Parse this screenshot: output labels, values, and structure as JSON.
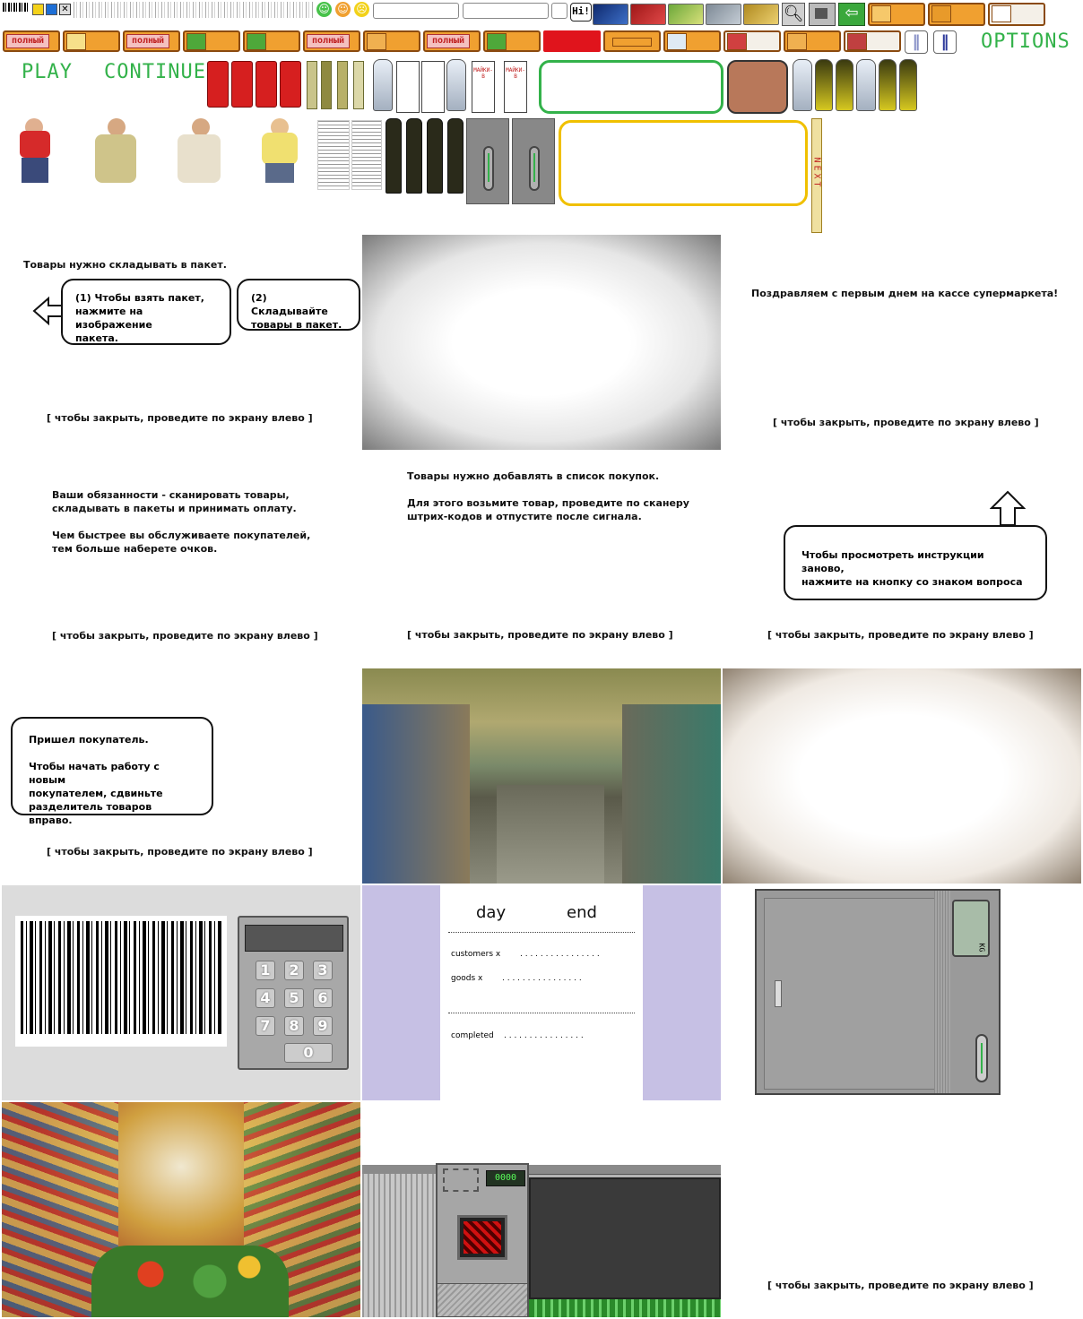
{
  "sprites": {
    "full_label": "полный",
    "hi_label": "Hi!",
    "play_label": "PLAY",
    "continue_label": "CONTINUE",
    "options_label": "OPTIONS",
    "next_label": "NEXT",
    "milk_brand": "МАЙКИ-В",
    "scale_unit": "KG"
  },
  "colors": {
    "menu_green": "#33b24a",
    "orange_button": "#f0a030",
    "red_button": "#e0141c",
    "yellow_frame": "#f0c000",
    "pause_blue": "#2d3a9b",
    "summary_lilac": "#c6c0e4"
  },
  "tutorial": {
    "bag_intro": "Товары нужно складывать в пакет.",
    "bag_step1": "(1) Чтобы взять пакет,\nнажмите на изображение\nпакета.",
    "bag_step2": "(2) Складывайте\nтовары в пакет.",
    "close_hint": "[ чтобы закрыть, проведите по экрану влево ]",
    "congrats": "Поздравляем с первым днем на кассе супермаркета!",
    "duties": "Ваши обязанности - сканировать товары,\nскладывать в пакеты и принимать оплату.\n\nЧем быстрее вы обслуживаете покупателей,\nтем больше наберете очков.",
    "scan": "Товары нужно добавлять в список покупок.\n\nДля этого возьмите товар, проведите по сканеру\nштрих-кодов и отпустите после сигнала.",
    "help_hint": "Чтобы просмотреть инструкции заново,\nнажмите на кнопку со знаком вопроса",
    "customer": "Пришел покупатель.\n\nЧтобы начать работу с новым\nпокупателем, сдвиньте\nразделитель товаров вправо."
  },
  "keypad": {
    "keys": [
      "1",
      "2",
      "3",
      "4",
      "5",
      "6",
      "7",
      "8",
      "9",
      "0"
    ]
  },
  "summary": {
    "title_left": "day",
    "title_right": "end",
    "customers_label": "customers x",
    "goods_label": "goods x",
    "completed_label": "completed",
    "leader": ". . . . . . . . . . . . . . . ."
  },
  "register": {
    "display": "0000"
  }
}
